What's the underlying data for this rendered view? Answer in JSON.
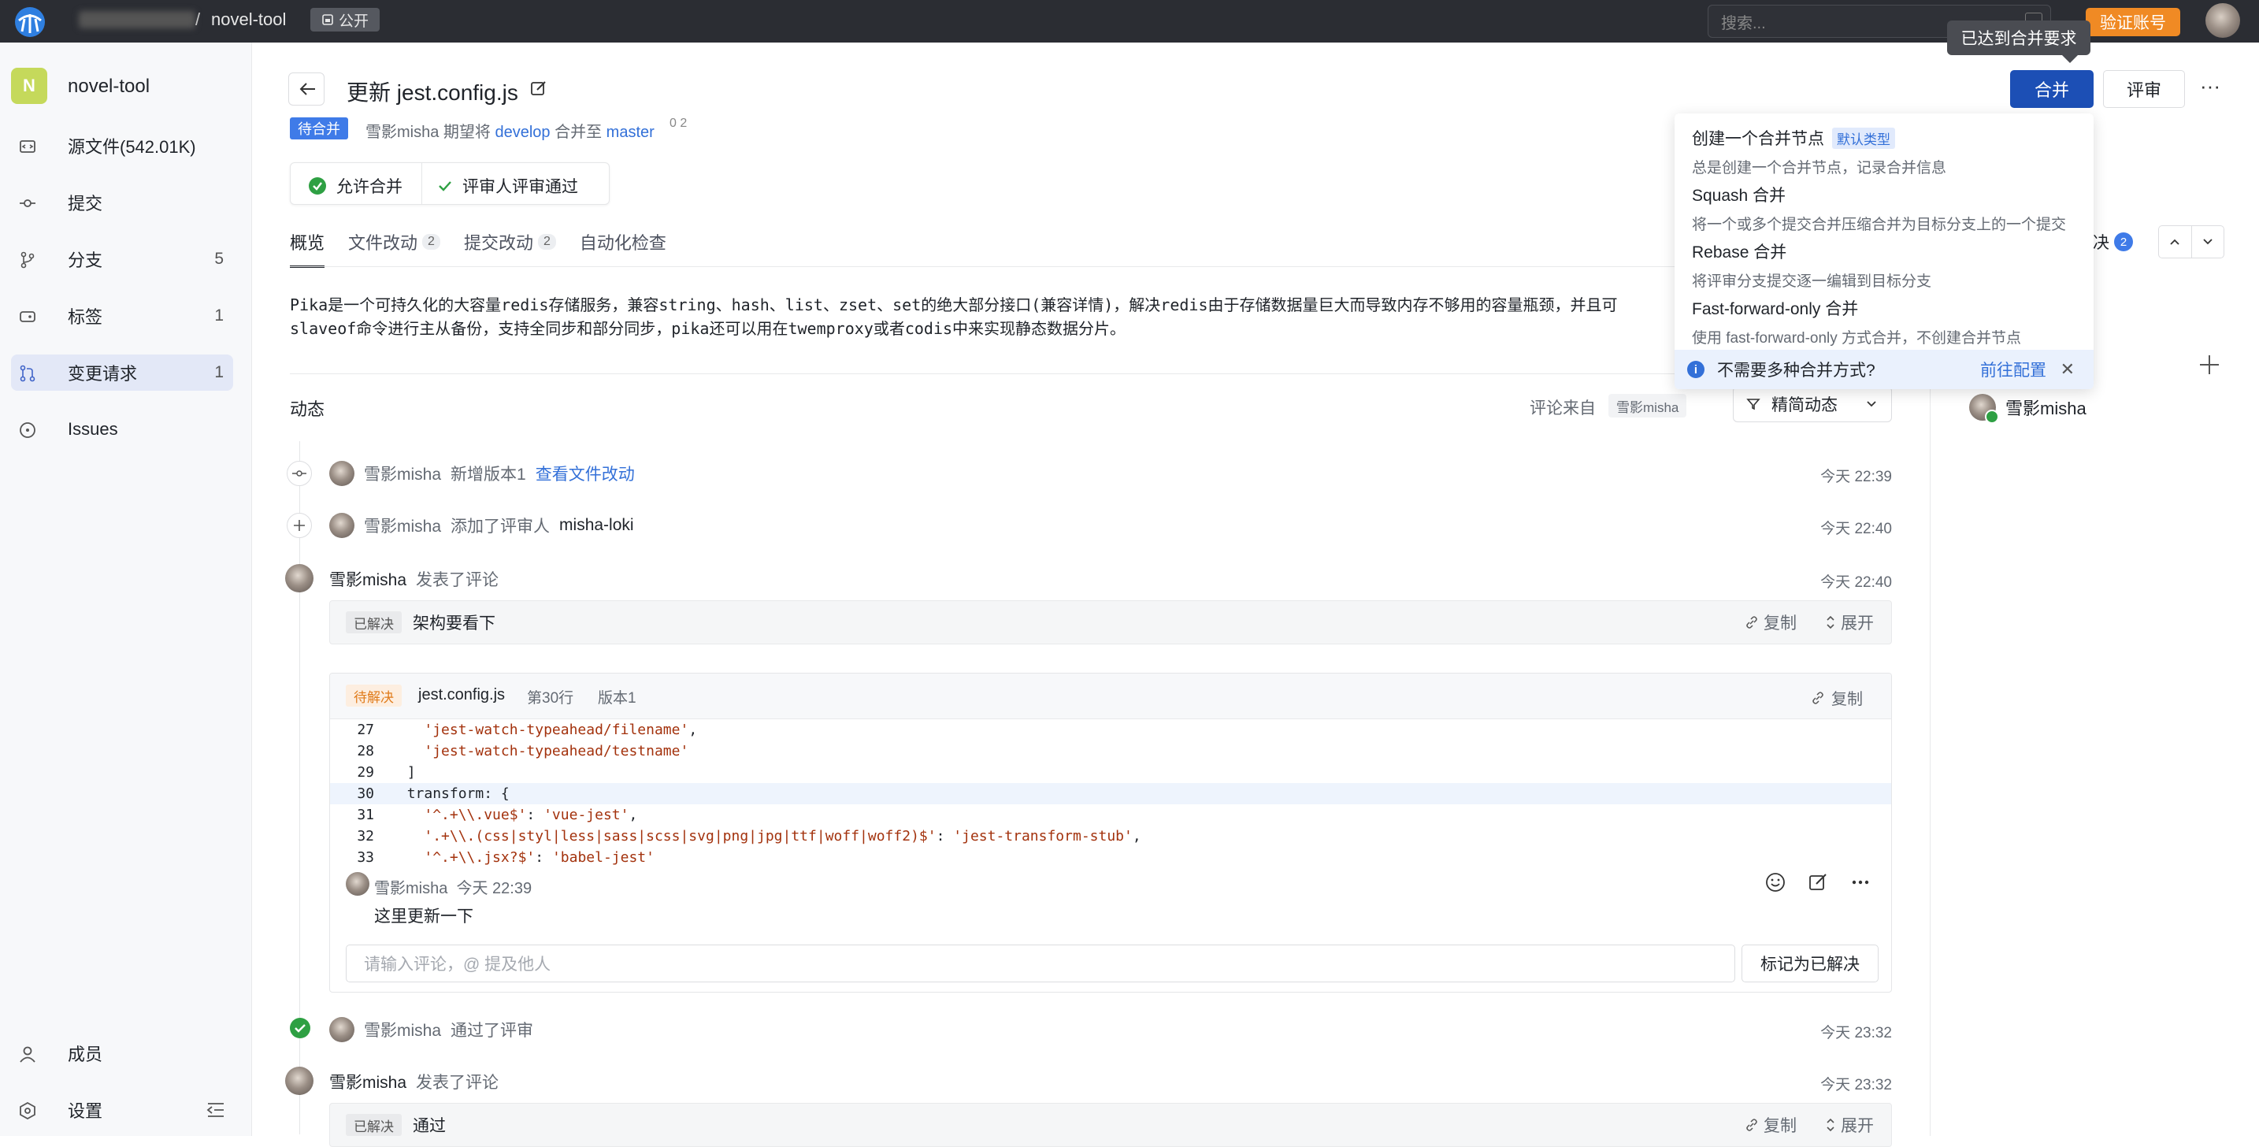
{
  "topbar": {
    "separator": "/",
    "repo": "novel-tool",
    "visibility": "公开",
    "search_placeholder": "搜索...",
    "verify_label": "验证账号"
  },
  "sidebar": {
    "project_initial": "N",
    "project_name": "novel-tool",
    "items": [
      {
        "label": "源文件(542.01K)",
        "count": "",
        "icon": "code-icon"
      },
      {
        "label": "提交",
        "count": "",
        "icon": "commit-icon"
      },
      {
        "label": "分支",
        "count": "5",
        "icon": "branch-icon"
      },
      {
        "label": "标签",
        "count": "1",
        "icon": "tag-icon"
      },
      {
        "label": "变更请求",
        "count": "1",
        "icon": "merge-request-icon"
      },
      {
        "label": "Issues",
        "count": "",
        "icon": "issue-icon"
      }
    ],
    "bottom": [
      {
        "label": "成员",
        "icon": "user-icon"
      },
      {
        "label": "设置",
        "icon": "settings-icon"
      }
    ]
  },
  "mr": {
    "title": "更新 jest.config.js",
    "status": "待合并",
    "author": "雪影misha",
    "desc_mid": "期望将",
    "source": "develop",
    "desc_to": "合并至",
    "target": "master",
    "stat_a": "0",
    "stat_b": "2",
    "merge_label": "合并",
    "review_label": "评审",
    "more_label": "···",
    "tooltip": "已达到合并要求"
  },
  "checks": [
    {
      "label": "允许合并"
    },
    {
      "label": "评审人评审通过"
    }
  ],
  "tabs": [
    {
      "label": "概览",
      "count": ""
    },
    {
      "label": "文件改动",
      "count": "2"
    },
    {
      "label": "提交改动",
      "count": "2"
    },
    {
      "label": "自动化检查",
      "count": ""
    }
  ],
  "body": {
    "line1": "Pika是一个可持久化的大容量redis存储服务，兼容string、hash、list、zset、set的绝大部分接口(兼容详情)，解决redis由于存储数据量巨大而导致内存不够用的容量瓶颈，并且可",
    "line2": "slaveof命令进行主从备份，支持全同步和部分同步，pika还可以用在twemproxy或者codis中来实现静态数据分片。"
  },
  "activity": {
    "title": "动态",
    "comment_from": "评论来自",
    "comment_from_tag": "雪影misha",
    "filter_label": "精简动态",
    "events": [
      {
        "user": "雪影misha",
        "action": "新增版本1",
        "extra": "查看文件改动",
        "time": "今天 22:39"
      },
      {
        "user": "雪影misha",
        "action": "添加了评审人",
        "extra": "misha-loki",
        "time": "今天 22:40"
      },
      {
        "user": "雪影misha",
        "action": "发表了评论",
        "extra": "",
        "time": "今天 22:40"
      },
      {
        "user": "雪影misha",
        "action": "通过了评审",
        "extra": "",
        "time": "今天 23:32"
      },
      {
        "user": "雪影misha",
        "action": "发表了评论",
        "extra": "",
        "time": "今天 23:32"
      }
    ],
    "comment1": {
      "tag": "已解决",
      "text": "架构要看下",
      "copy": "复制",
      "expand": "展开"
    },
    "comment2": {
      "tag": "已解决",
      "text": "通过",
      "copy": "复制",
      "expand": "展开"
    }
  },
  "code_card": {
    "tag": "待解决",
    "file": "jest.config.js",
    "line": "第30行",
    "version": "版本1",
    "copy": "复制",
    "lines": [
      {
        "no": "27",
        "pre": "    ",
        "str": "'jest-watch-typeahead/filename'",
        "post": ","
      },
      {
        "no": "28",
        "pre": "    ",
        "str": "'jest-watch-typeahead/testname'",
        "post": ""
      },
      {
        "no": "29",
        "pre": "  ",
        "str": "",
        "post": "]"
      },
      {
        "no": "30",
        "pre": "  ",
        "str": "",
        "post": "transform: {"
      },
      {
        "no": "31",
        "pre": "    ",
        "str": "'^.+\\\\.vue$'",
        "post": ": ",
        "str2": "'vue-jest'",
        "post2": ","
      },
      {
        "no": "32",
        "pre": "    ",
        "str": "'.+\\\\.(css|styl|less|sass|scss|svg|png|jpg|ttf|woff|woff2)$'",
        "post": ": ",
        "str2": "'jest-transform-stub'",
        "post2": ","
      },
      {
        "no": "33",
        "pre": "    ",
        "str": "'^.+\\\\.jsx?$'",
        "post": ": ",
        "str2": "'babel-jest'",
        "post2": ""
      }
    ],
    "inner_user": "雪影misha",
    "inner_time": "今天 22:39",
    "inner_text": "这里更新一下",
    "input_placeholder": "请输入评论，@ 提及他人",
    "mark_resolved": "标记为已解决"
  },
  "right_panel": {
    "resolve_frag": "解决",
    "resolve_count": "2",
    "reviewer": "雪影misha"
  },
  "merge_dropdown": {
    "items": [
      {
        "title": "创建一个合并节点",
        "tag": "默认类型",
        "desc": "总是创建一个合并节点，记录合并信息"
      },
      {
        "title": "Squash 合并",
        "tag": "",
        "desc": "将一个或多个提交合并压缩合并为目标分支上的一个提交"
      },
      {
        "title": "Rebase 合并",
        "tag": "",
        "desc": "将评审分支提交逐一编辑到目标分支"
      },
      {
        "title": "Fast-forward-only 合并",
        "tag": "",
        "desc": "使用 fast-forward-only 方式合并，不创建合并节点"
      }
    ],
    "footer_text": "不需要多种合并方式?",
    "footer_link": "前往配置",
    "close": "✕"
  }
}
